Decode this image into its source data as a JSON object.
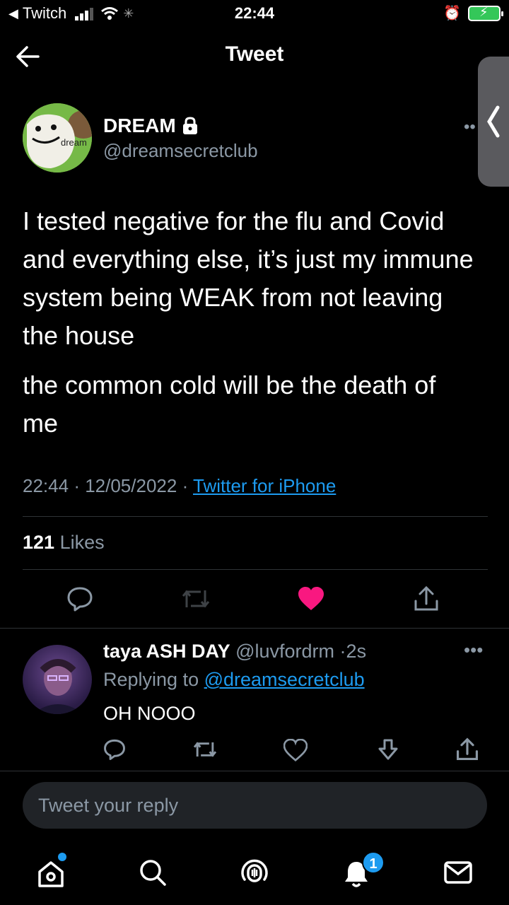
{
  "status_bar": {
    "back_app": "Twitch",
    "time": "22:44"
  },
  "header": {
    "title": "Tweet"
  },
  "tweet": {
    "author_name": "DREAM",
    "author_handle": "@dreamsecretclub",
    "avatar_text": "dream",
    "paragraphs": [
      "I tested negative for the flu and Covid and everything else, it’s just my immune system being WEAK from not leaving the house",
      "the common cold will be the death of me"
    ],
    "time": "22:44",
    "date": "12/05/2022",
    "source": "Twitter for iPhone",
    "likes_count": "121",
    "likes_label": "Likes",
    "liked": true
  },
  "reply": {
    "author_name": "taya ASH DAY",
    "author_handle": "@luvfordrm",
    "age": "2s",
    "replying_to_label": "Replying to",
    "replying_to_handle": "@dreamsecretclub",
    "text": "OH NOOO"
  },
  "compose": {
    "placeholder": "Tweet your reply"
  },
  "tab_bar": {
    "notifications_badge": "1"
  },
  "colors": {
    "accent": "#1d9bf0",
    "like": "#f91880",
    "muted": "#8b98a5"
  }
}
